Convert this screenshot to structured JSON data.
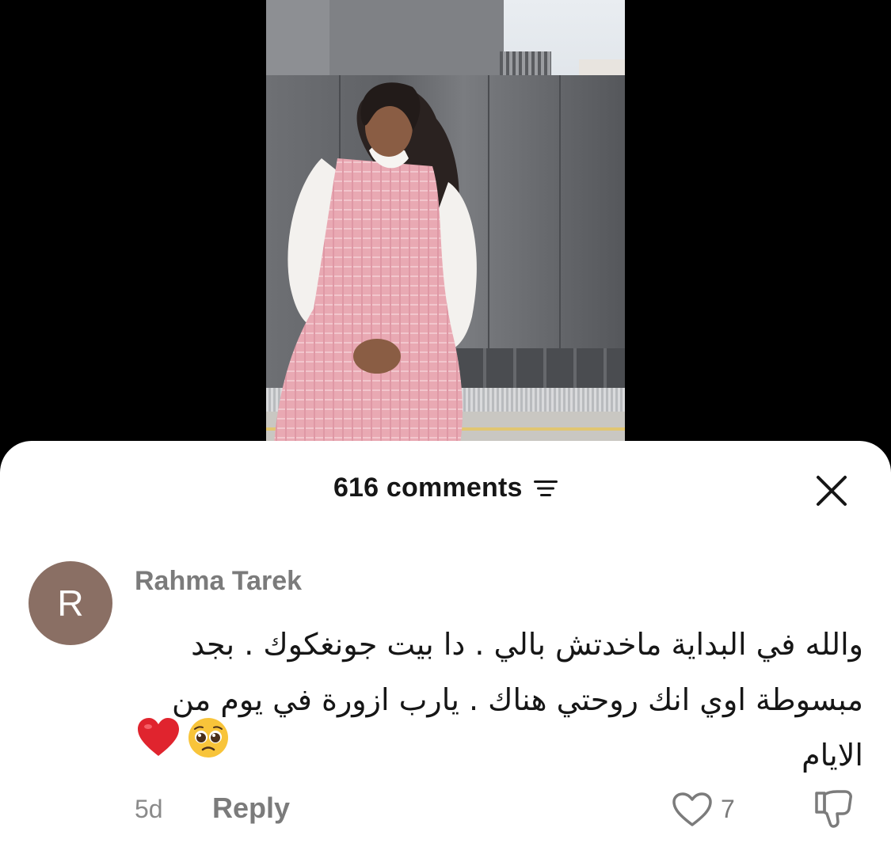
{
  "comments_header": {
    "count_label": "616 comments"
  },
  "comment": {
    "avatar_initial": "R",
    "username": "Rahma Tarek",
    "text": "والله في البداية ماخدتش بالي . دا بيت جونغكوك . بجد مبسوطة اوي انك روحتي هناك . يارب ازورة في يوم من الايام",
    "emojis": [
      "heart-icon",
      "pleading-face-icon"
    ],
    "time": "5d",
    "reply_label": "Reply",
    "like_count": "7"
  },
  "colors": {
    "avatar_bg": "#8a6f64",
    "sheet_bg": "#ffffff",
    "heart_red": "#e0242e",
    "muted_text": "#7b7b7b"
  }
}
